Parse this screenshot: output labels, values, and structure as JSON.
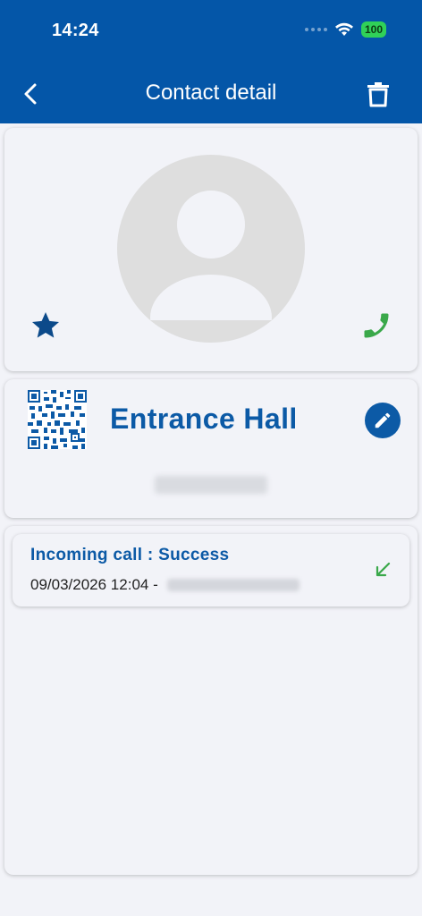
{
  "status_bar": {
    "time": "14:24",
    "battery": "100"
  },
  "header": {
    "title": "Contact detail"
  },
  "contact": {
    "name": "Entrance Hall",
    "favorite": true
  },
  "history": [
    {
      "status": "Incoming call : Success",
      "datetime": "09/03/2026 12:04",
      "separator": " - "
    }
  ],
  "icons": {
    "back": "chevron-left-icon",
    "delete": "trash-icon",
    "favorite": "star-icon",
    "call": "phone-icon",
    "qr": "qr-code-icon",
    "edit": "pencil-icon",
    "incoming": "arrow-down-left-icon"
  },
  "colors": {
    "primary": "#0456a8",
    "accent": "#0c5aa6",
    "call_green": "#3aa84a",
    "avatar_gray": "#dedede"
  }
}
